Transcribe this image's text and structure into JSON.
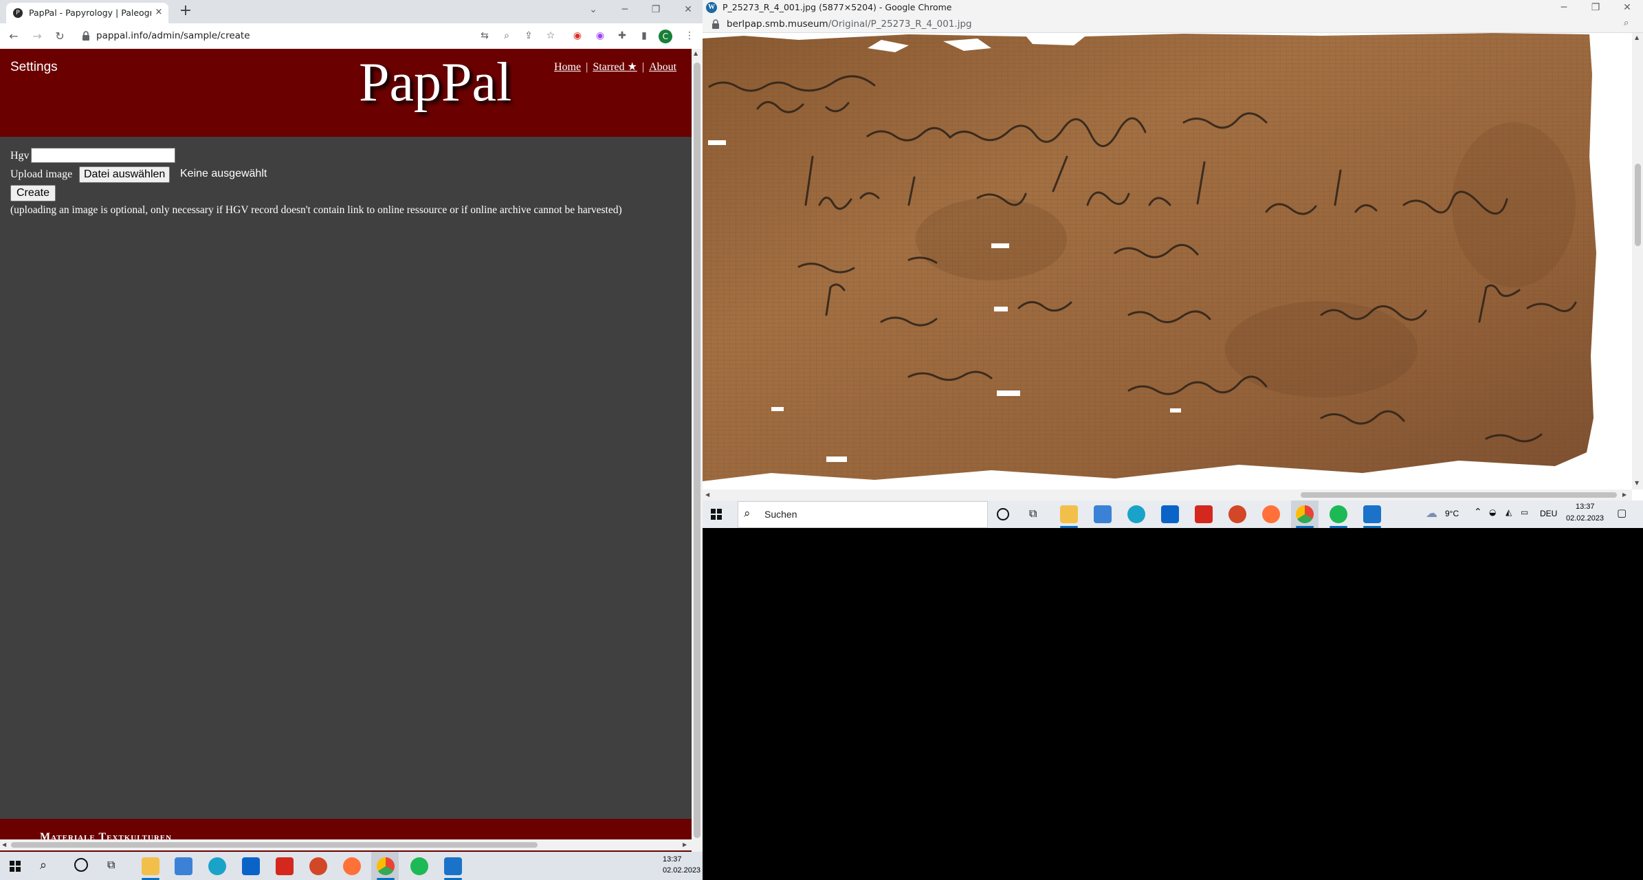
{
  "left_window": {
    "tab_title": "PapPal - Papyrology | Paleograph",
    "tab_favicon": "pappal-favicon",
    "tab_close": "×",
    "new_tab": "+",
    "url": "pappal.info/admin/sample/create",
    "window_controls": {
      "minimize": "─",
      "restore": "❐",
      "close": "✕"
    },
    "profile_initial": "C"
  },
  "page": {
    "settings_label": "Settings",
    "logo": "PapPal",
    "nav": {
      "home": "Home",
      "starred": "Starred ★",
      "about": "About",
      "separator": "|"
    },
    "form": {
      "hgv_label": "Hgv",
      "hgv_value": "",
      "upload_label": "Upload image",
      "file_button": "Datei auswählen",
      "file_status": "Keine ausgewählt",
      "create_button": "Create",
      "hint": "(uploading an image is optional, only necessary if HGV record doesn't contain link to online ressource or if online archive cannot be harvested)"
    },
    "footer_text": "Materiale Textkulturen"
  },
  "right_window": {
    "title": "P_25273_R_4_001.jpg (5877×5204) - Google Chrome",
    "url_host": "berlpap.smb.museum",
    "url_path": "/Original/P_25273_R_4_001.jpg",
    "favicon": "wordpress-favicon",
    "window_controls": {
      "minimize": "─",
      "restore": "❐",
      "close": "✕"
    }
  },
  "taskbar_right": {
    "search_placeholder": "Suchen",
    "weather": "9°C",
    "language": "DEU",
    "time": "13:37",
    "date": "02.02.2023"
  },
  "taskbar_left": {
    "time": "13:37",
    "date": "02.02.2023"
  },
  "colors": {
    "pappal_red": "#6b0000",
    "page_bg": "#404040",
    "papyrus": "#9b6a3e"
  }
}
